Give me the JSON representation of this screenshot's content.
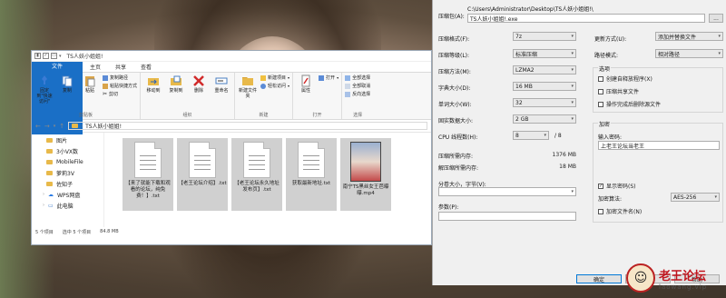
{
  "explorer": {
    "title": "TS人妖小姐姐!",
    "tabs": [
      "文件",
      "主页",
      "共享",
      "查看"
    ],
    "ribbon": {
      "clipboard": {
        "pin": "固定到\"快速访问\"",
        "copy": "复制",
        "paste": "粘贴",
        "copy_path": "复制路径",
        "paste_shortcut": "粘贴快捷方式",
        "cut": "剪切",
        "label": "剪贴板"
      },
      "organize": {
        "move_to": "移动到",
        "copy_to": "复制到",
        "delete": "删除",
        "rename": "重命名",
        "label": "组织"
      },
      "new": {
        "new_folder": "新建文件夹",
        "new_item": "新建项目",
        "easy_access": "轻松访问",
        "label": "新建"
      },
      "open": {
        "properties": "属性",
        "open": "打开",
        "label": "打开"
      },
      "select": {
        "select_all": "全部选择",
        "select_none": "全部取消",
        "invert": "反向选择",
        "label": "选择"
      }
    },
    "address": "TS人妖小姐姐!",
    "nav_items": [
      "图片",
      "3小VX数",
      "MobileFile",
      "萝莉3V",
      "佐知子"
    ],
    "wps": "WPS网盘",
    "this_pc": "此电脑",
    "files": [
      {
        "name": "【来了就能下载和观看的论坛，纯免费！】.txt",
        "type": "doc"
      },
      {
        "name": "【老王论坛介绍】.txt",
        "type": "doc"
      },
      {
        "name": "【老王论坛永久地址发布页】.txt",
        "type": "doc"
      },
      {
        "name": "获取最新地址.txt",
        "type": "doc"
      },
      {
        "name": "南宁TS黑丝女王芭曝曝.mp4",
        "type": "video"
      }
    ],
    "status": {
      "count": "5 个项目",
      "selected": "选中 5 个项目",
      "size": "84.8 MB"
    }
  },
  "dialog": {
    "archive_label": "压缩包(A):",
    "archive_path": "C:\\Users\\Administrator\\Desktop\\TS人妖小姐姐!\\",
    "archive_name": "TS人妖小姐姐!.exe",
    "browse": "...",
    "format_label": "压缩格式(F):",
    "format": "7z",
    "level_label": "压缩等级(L):",
    "level": "标准压缩",
    "method_label": "压缩方法(M):",
    "method": "LZMA2",
    "dict_label": "字典大小(D):",
    "dict": "16 MB",
    "word_label": "单词大小(W):",
    "word": "32",
    "solid_label": "固实数据大小:",
    "solid": "2 GB",
    "cpu_label": "CPU 线程数(H):",
    "cpu": "8",
    "cpu_total": "/ 8",
    "mem_comp_label": "压缩所需内存:",
    "mem_comp": "1376 MB",
    "mem_decomp_label": "解压缩所需内存:",
    "mem_decomp": "18 MB",
    "split_label": "分卷大小，字节(V):",
    "params_label": "参数(P):",
    "update_label": "更新方式(U):",
    "update": "添加并替换文件",
    "path_label": "路径模式:",
    "path": "相对路径",
    "options_label": "选项",
    "opt_sfx": "创建自释放程序(X)",
    "opt_shared": "压缩共享文件",
    "opt_delete": "操作完成后删除源文件",
    "encrypt_label": "加密",
    "password_label": "输入密码:",
    "password": "上老王论坛当老王",
    "show_password": "显示密码(S)",
    "enc_method_label": "加密算法:",
    "enc_method": "AES-256",
    "enc_names": "加密文件名(N)",
    "ok": "确定",
    "cancel": "取消",
    "help": "帮助"
  },
  "watermark": {
    "title": "老王论坛",
    "url": "laowang.vip"
  }
}
